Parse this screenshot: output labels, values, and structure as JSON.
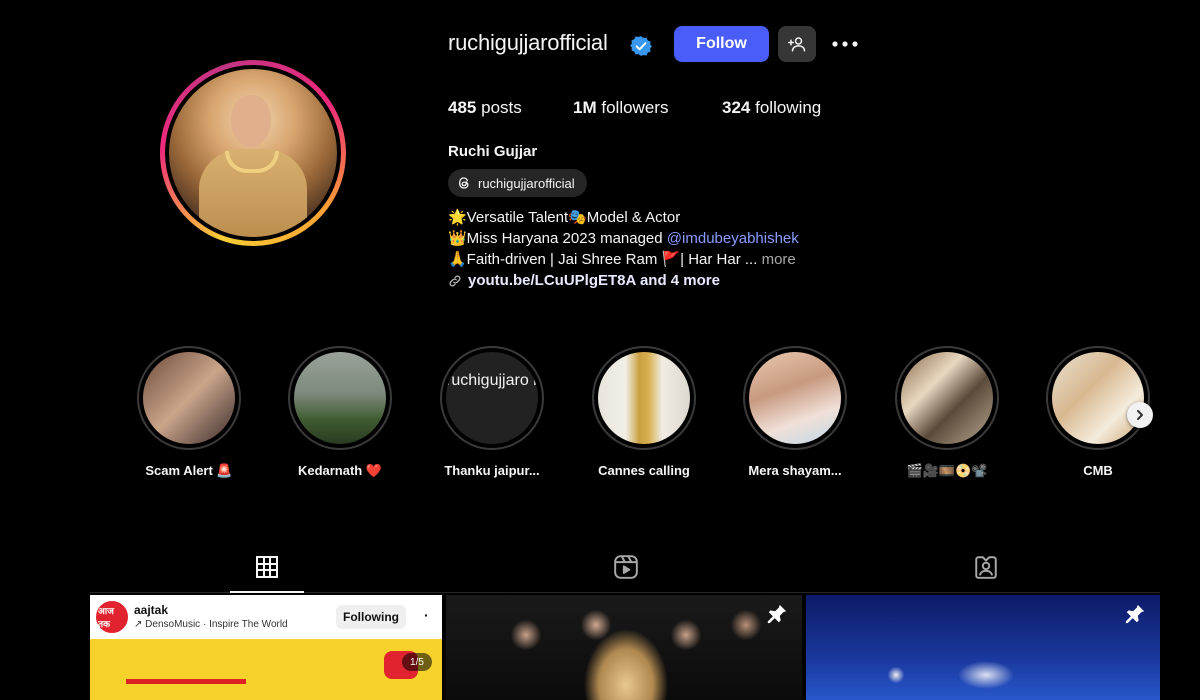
{
  "profile": {
    "username": "ruchigujjarofficial",
    "follow_label": "Follow",
    "stats": {
      "posts_count": "485",
      "posts_label": "posts",
      "followers_count": "1M",
      "followers_label": "followers",
      "following_count": "324",
      "following_label": "following"
    },
    "full_name": "Ruchi Gujjar",
    "threads_handle": "ruchigujjarofficial",
    "bio": {
      "line1": "🌟Versatile Talent🎭Model & Actor",
      "line2_prefix": "👑Miss Haryana 2023 managed ",
      "line2_mention": "@imdubeyabhishek",
      "line3": "🙏Faith-driven | Jai Shree Ram 🚩| Har Har ... ",
      "line3_more": "more",
      "link_text": "youtu.be/LCuUPlgET8A and 4 more"
    }
  },
  "highlights": [
    {
      "label": "Scam Alert 🚨"
    },
    {
      "label": "Kedarnath ❤️"
    },
    {
      "label": "Thanku jaipur...",
      "overlay_text": "ruchigujjaro highlight sto icture"
    },
    {
      "label": "Cannes calling"
    },
    {
      "label": "Mera shayam..."
    },
    {
      "label": "🎬🎥🎞️📀📽️"
    },
    {
      "label": "CMB"
    }
  ],
  "posts": {
    "post1": {
      "account": "aajtak",
      "sub": "↗ DensoMusic · Inspire The World",
      "following_label": "Following",
      "dots": "·",
      "counter": "1/5",
      "logo_text": "आज तक"
    }
  },
  "colors": {
    "accent": "#4a5df9",
    "background": "#000000",
    "verified": "#3897f0",
    "mention": "#8a9cff"
  },
  "icons": {
    "verified": "verified-badge-icon",
    "add_user": "add-user-icon",
    "more": "more-dots-icon",
    "threads": "threads-icon",
    "link": "link-icon",
    "next": "chevron-right-icon",
    "tab_posts": "grid-icon",
    "tab_reels": "reels-icon",
    "tab_tagged": "tagged-icon",
    "pin": "pin-icon"
  }
}
